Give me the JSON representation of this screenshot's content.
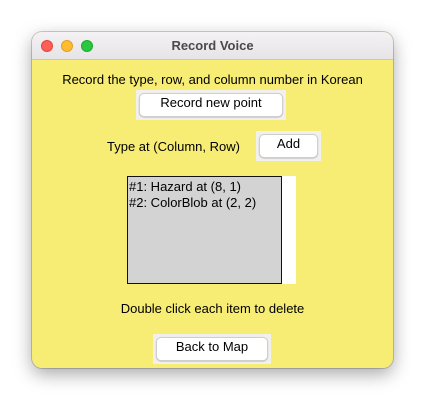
{
  "window": {
    "title": "Record Voice"
  },
  "instruction_text": "Record the type, row, and column number in Korean",
  "record_button_label": "Record new point",
  "type_label": "Type at (Column, Row)",
  "add_button_label": "Add",
  "points": [
    "#1: Hazard at (8, 1)",
    "#2: ColorBlob at (2, 2)"
  ],
  "delete_hint": "Double click each item to delete",
  "back_button_label": "Back to Map",
  "colors": {
    "window_background": "#f7ed75",
    "listbox_background": "#d3d3d3",
    "close": "#fe5f57",
    "minimize": "#febc2e",
    "maximize": "#28c840"
  }
}
